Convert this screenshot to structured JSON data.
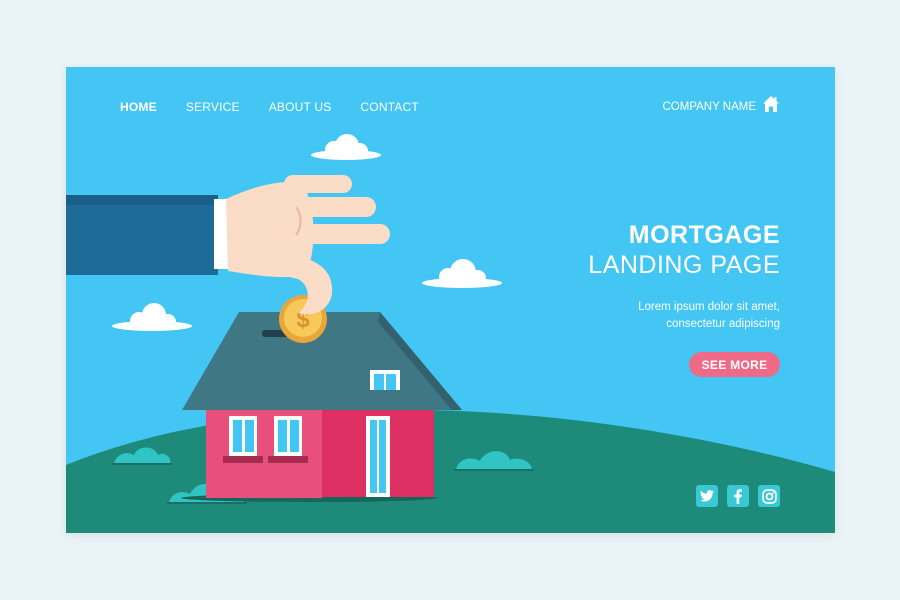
{
  "nav": {
    "items": [
      {
        "label": "HOME",
        "active": true
      },
      {
        "label": "SERVICE",
        "active": false
      },
      {
        "label": "ABOUT US",
        "active": false
      },
      {
        "label": "CONTACT",
        "active": false
      }
    ]
  },
  "brand": {
    "company_name": "COMPANY NAME",
    "icon": "house-icon"
  },
  "hero": {
    "title_bold": "MORTGAGE",
    "title_light": "LANDING PAGE",
    "subtitle_line1": "Lorem ipsum dolor sit amet,",
    "subtitle_line2": "consectetur adipiscing",
    "cta_label": "SEE MORE"
  },
  "social": [
    "twitter-icon",
    "facebook-icon",
    "instagram-icon"
  ],
  "colors": {
    "sky": "#43c6f3",
    "ground": "#1e8a7a",
    "house_wall": "#e84f7a",
    "roof": "#3f7785",
    "cta": "#ee6a86",
    "social": "#39c8d6",
    "coin": "#f2b844",
    "sleeve": "#1d6b96"
  }
}
